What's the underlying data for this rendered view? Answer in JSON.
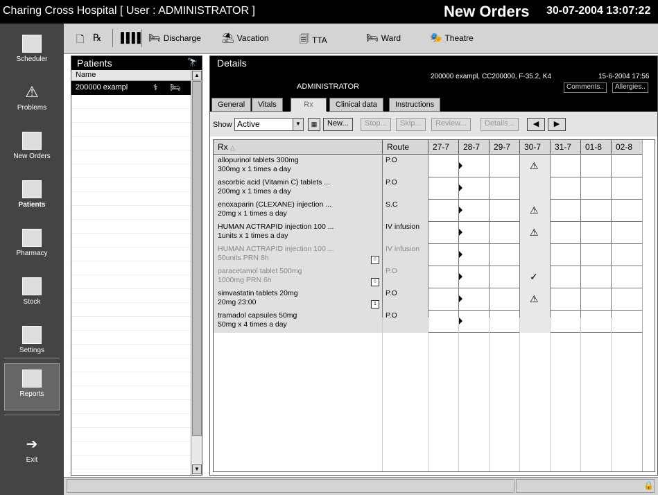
{
  "titlebar": {
    "app_title": "Charing Cross Hospital  [ User : ADMINISTRATOR ]",
    "screen_name": "New Orders",
    "datetime": "30-07-2004 13:07:22"
  },
  "nav": [
    {
      "label": "Scheduler",
      "icon": "calendar-icon"
    },
    {
      "label": "Problems",
      "icon": "warning-icon"
    },
    {
      "label": "New Orders",
      "icon": "orders-icon"
    },
    {
      "label": "Patients",
      "icon": "patients-icon"
    },
    {
      "label": "Pharmacy",
      "icon": "pharmacy-icon"
    },
    {
      "label": "Stock",
      "icon": "stock-icon"
    },
    {
      "label": "Settings",
      "icon": "settings-icon"
    },
    {
      "label": "Reports",
      "icon": "reports-icon"
    },
    {
      "label": "Exit",
      "icon": "exit-icon"
    }
  ],
  "toolbar": {
    "discharge": "Discharge",
    "vacation": "Vacation",
    "tta": "TTA",
    "ward": "Ward",
    "theatre": "Theatre"
  },
  "patients": {
    "title": "Patients",
    "column_name": "Name",
    "rows": [
      {
        "name": "200000 exampl"
      }
    ]
  },
  "details": {
    "title": "Details",
    "user": "ADMINISTRATOR",
    "patient_info": "200000 exampl, CC200000, F-35.2, K4",
    "patient_date": "15-6-2004 17:56",
    "comments_btn": "Comments..",
    "allergies_btn": "Allergies..",
    "tabs": [
      "General",
      "Vitals",
      "Rx",
      "Clinical data",
      "Instructions"
    ],
    "active_tab": "Rx",
    "show_label": "Show",
    "show_value": "Active",
    "buttons": {
      "new": "New...",
      "stop": "Stop...",
      "skip": "Skip...",
      "review": "Review...",
      "details": "Details..."
    }
  },
  "grid": {
    "col_rx": "Rx",
    "col_route": "Route",
    "days": [
      "27-7",
      "28-7",
      "29-7",
      "30-7",
      "31-7",
      "01-8",
      "02-8"
    ],
    "rows": [
      {
        "drug": "allopurinol tablets 300mg",
        "dose": "300mg x 1 times a day",
        "route": "P.O",
        "mark": "warning",
        "status": "active",
        "prn": ""
      },
      {
        "drug": "ascorbic acid (Vitamin C) tablets ...",
        "dose": "200mg x 1 times a day",
        "route": "P.O",
        "mark": "",
        "status": "active",
        "prn": ""
      },
      {
        "drug": "enoxaparin (CLEXANE) injection ...",
        "dose": "20mg x 1 times a day",
        "route": "S.C",
        "mark": "warning",
        "status": "active",
        "prn": ""
      },
      {
        "drug": "HUMAN ACTRAPID injection 100 ...",
        "dose": "1units x 1 times a day",
        "route": "IV infusion",
        "mark": "warning",
        "status": "active",
        "prn": ""
      },
      {
        "drug": "HUMAN ACTRAPID injection 100 ...",
        "dose": "50units PRN 8h",
        "route": "IV infusion",
        "mark": "",
        "status": "gray",
        "prn": "8"
      },
      {
        "drug": "paracetamol  tablet 500mg",
        "dose": "1000mg PRN 6h",
        "route": "P.O",
        "mark": "check",
        "status": "gray",
        "prn": "6"
      },
      {
        "drug": "simvastatin tablets 20mg",
        "dose": "20mg 23:00",
        "route": "P.O",
        "mark": "warning",
        "status": "active",
        "prn": "1"
      },
      {
        "drug": "tramadol capsules 50mg",
        "dose": "50mg x 4 times a day",
        "route": "P.O",
        "mark": "",
        "status": "active",
        "prn": ""
      }
    ]
  }
}
